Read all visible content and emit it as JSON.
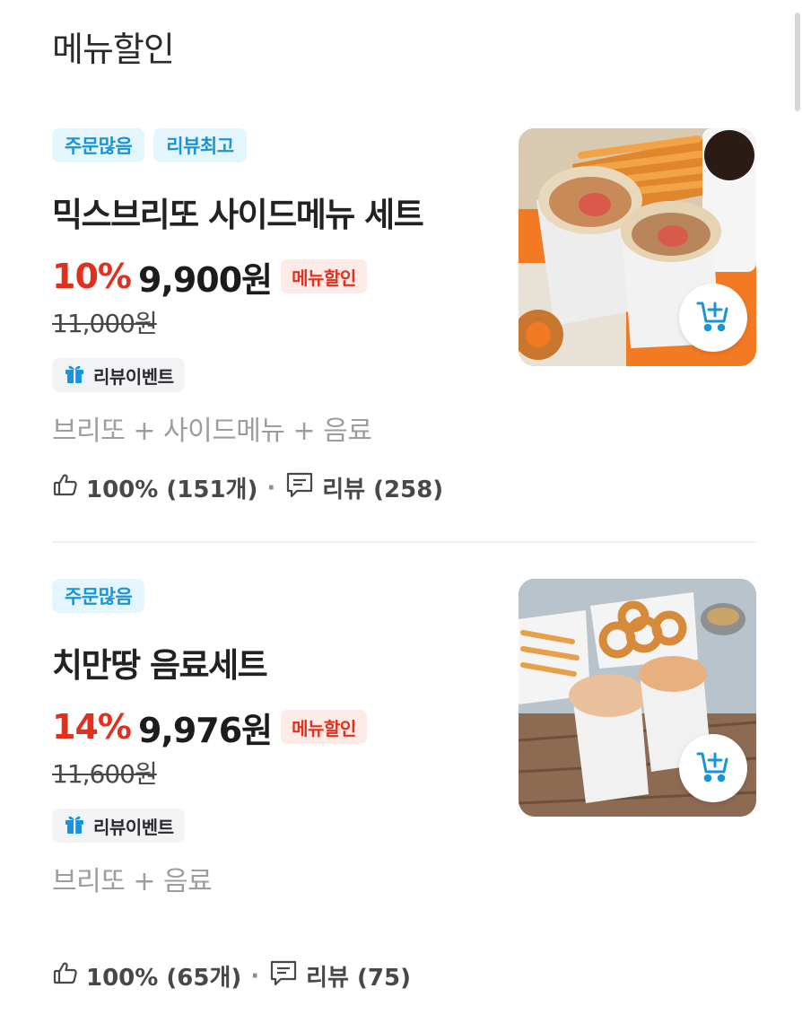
{
  "section": {
    "title": "메뉴할인"
  },
  "colors": {
    "accent_red": "#e0301e",
    "tag_blue": "#1a94d8",
    "cart_blue": "#1a94d8"
  },
  "menus": [
    {
      "tags": [
        "주문많음",
        "리뷰최고"
      ],
      "name": "믹스브리또 사이드메뉴 세트",
      "discount_rate": "10%",
      "price": "9,900원",
      "badge": "메뉴할인",
      "original_price": "11,000원",
      "event": {
        "icon": "gift-icon",
        "label": "리뷰이벤트"
      },
      "description": "브리또 + 사이드메뉴 + 음료",
      "rating": "100% (151개)",
      "reviews": "리뷰 (258)",
      "image_icon": "cart-add-icon"
    },
    {
      "tags": [
        "주문많음"
      ],
      "name": "치만땅 음료세트",
      "discount_rate": "14%",
      "price": "9,976원",
      "badge": "메뉴할인",
      "original_price": "11,600원",
      "event": {
        "icon": "gift-icon",
        "label": "리뷰이벤트"
      },
      "description": "브리또 + 음료",
      "rating": "100% (65개)",
      "reviews": "리뷰 (75)",
      "image_icon": "cart-add-icon"
    }
  ],
  "stats_separator": "·"
}
